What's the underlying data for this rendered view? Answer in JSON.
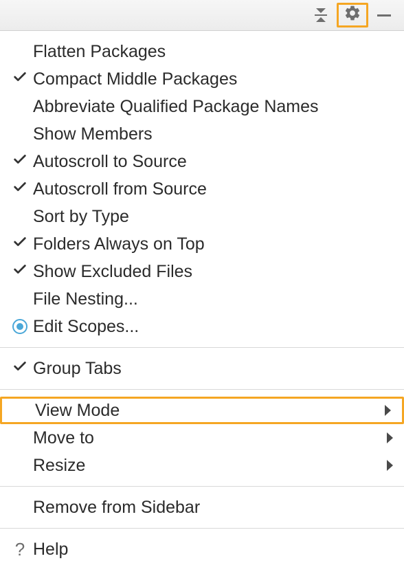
{
  "toolbar": {
    "collapse": "collapse",
    "gear": "settings",
    "minimize": "minimize"
  },
  "menu": {
    "section1": [
      {
        "label": "Flatten Packages",
        "checked": false
      },
      {
        "label": "Compact Middle Packages",
        "checked": true
      },
      {
        "label": "Abbreviate Qualified Package Names",
        "checked": false
      },
      {
        "label": "Show Members",
        "checked": false
      },
      {
        "label": "Autoscroll to Source",
        "checked": true
      },
      {
        "label": "Autoscroll from Source",
        "checked": true
      },
      {
        "label": "Sort by Type",
        "checked": false
      },
      {
        "label": "Folders Always on Top",
        "checked": true
      },
      {
        "label": "Show Excluded Files",
        "checked": true
      },
      {
        "label": "File Nesting...",
        "checked": false
      },
      {
        "label": "Edit Scopes...",
        "radio": true
      }
    ],
    "section2": [
      {
        "label": "Group Tabs",
        "checked": true
      }
    ],
    "section3": [
      {
        "label": "View Mode",
        "submenu": true,
        "highlighted": true
      },
      {
        "label": "Move to",
        "submenu": true
      },
      {
        "label": "Resize",
        "submenu": true
      }
    ],
    "section4": [
      {
        "label": "Remove from Sidebar"
      }
    ],
    "section5": [
      {
        "label": "Help",
        "help": true
      }
    ]
  }
}
